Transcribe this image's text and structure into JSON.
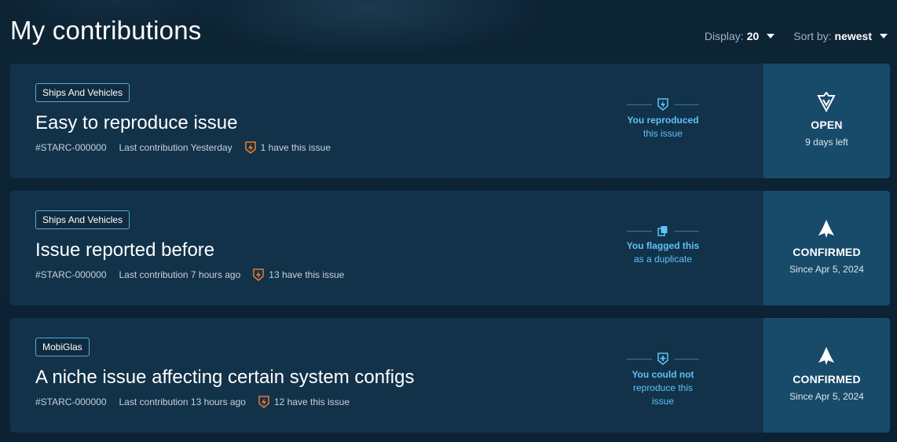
{
  "page_title": "My contributions",
  "controls": {
    "display_label": "Display:",
    "display_value": "20",
    "sort_label": "Sort by:",
    "sort_value": "newest"
  },
  "colors": {
    "background": "#0c2233",
    "card": "#12324a",
    "status_panel": "#184a6a",
    "accent_blue": "#5ec3f5",
    "bolt_orange": "#f07a2a"
  },
  "contributions": [
    {
      "category": "Ships And Vehicles",
      "title": "Easy to reproduce issue",
      "id": "#STARC-000000",
      "last_contribution": "Last contribution Yesterday",
      "count_text": "1 have this issue",
      "action_icon": "reproduced-bolt-icon",
      "action_line1": "You reproduced",
      "action_line2": "this issue",
      "status_icon": "open-emblem-icon",
      "status": "OPEN",
      "status_sub": "9 days left"
    },
    {
      "category": "Ships And Vehicles",
      "title": "Issue reported before",
      "id": "#STARC-000000",
      "last_contribution": "Last contribution 7 hours ago",
      "count_text": "13 have this issue",
      "action_icon": "duplicate-icon",
      "action_line1": "You flagged this",
      "action_line2": "as a duplicate",
      "status_icon": "confirmed-ship-icon",
      "status": "CONFIRMED",
      "status_sub": "Since Apr 5, 2024"
    },
    {
      "category": "MobiGlas",
      "title": "A niche issue affecting certain system configs",
      "id": "#STARC-000000",
      "last_contribution": "Last contribution 13 hours ago",
      "count_text": "12 have this issue",
      "action_icon": "shield-plus-icon",
      "action_line1": "You could not",
      "action_line2": "reproduce this issue",
      "status_icon": "confirmed-ship-icon",
      "status": "CONFIRMED",
      "status_sub": "Since Apr 5, 2024"
    }
  ]
}
